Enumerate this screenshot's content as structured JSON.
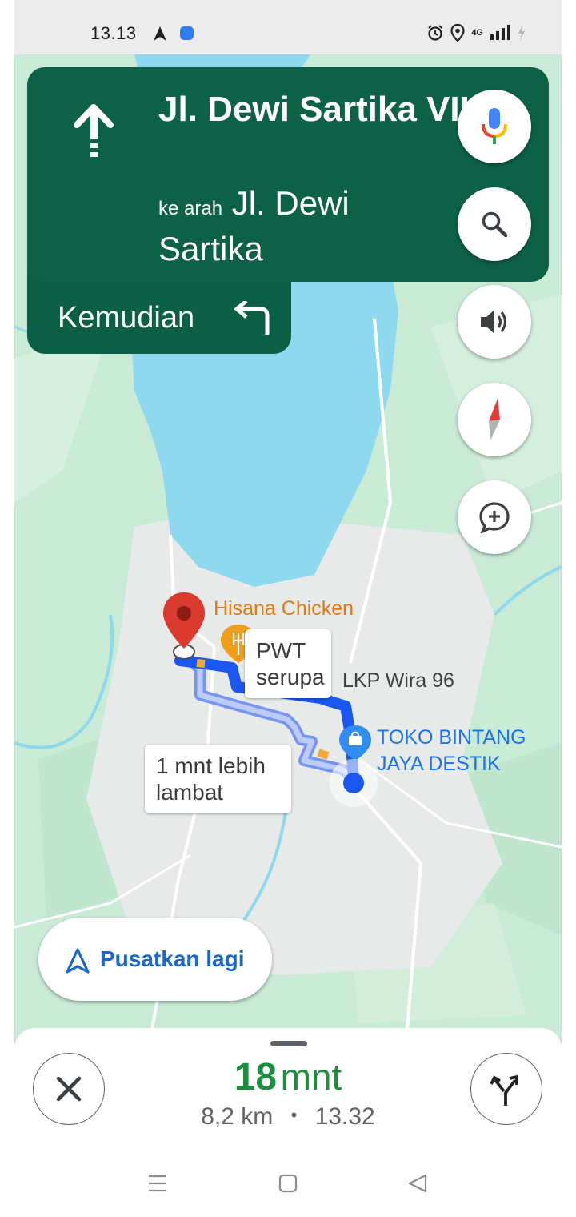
{
  "status_bar": {
    "time": "13.13",
    "network": "4G"
  },
  "guidance": {
    "street": "Jl. Dewi Sartika VII",
    "toward_prefix": "ke arah",
    "toward_street": "Jl. Dewi Sartika",
    "then_label": "Kemudian"
  },
  "map": {
    "poi_restaurant": "Hisana Chicken",
    "poi_school": "LKP Wira 96",
    "poi_shop": "TOKO BINTANG JAYA DESTIK",
    "callout_alt_route": "PWT serupa",
    "callout_slower": "1 mnt lebih lambat"
  },
  "recenter": {
    "label": "Pusatkan lagi"
  },
  "trip": {
    "eta_number": "18",
    "eta_unit": "mnt",
    "distance": "8,2 km",
    "separator": "•",
    "arrival_time": "13.32"
  },
  "icons": {
    "maneuver": "straight-arrow-icon",
    "then_maneuver": "turn-left-icon",
    "voice": "mic-icon",
    "search": "search-icon",
    "sound": "volume-icon",
    "compass": "compass-icon",
    "report": "add-report-icon",
    "recenter": "navigation-arrow-icon",
    "close": "close-icon",
    "alternates": "alternate-routes-icon"
  },
  "colors": {
    "banner": "#0c6147",
    "route": "#1a57f0",
    "eta": "#1e8e3e",
    "water": "#8fd9ee",
    "land": "#c9ebd6",
    "destination_pin": "#db3a2e"
  }
}
